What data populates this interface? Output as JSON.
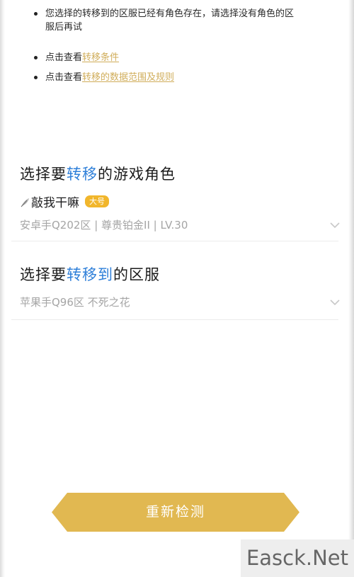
{
  "notes": {
    "items": [
      {
        "text": "您选择的转移到的区服已经有角色存在，请选择没有角色的区服后再试"
      },
      {
        "prefix": "点击查看",
        "link": "转移条件"
      },
      {
        "prefix": "点击查看",
        "link": "转移的数据范围及规则"
      }
    ]
  },
  "role_section": {
    "title_before": "选择要",
    "title_highlight": "转移",
    "title_after": "的游戏角色",
    "icon": "feather-icon",
    "role_name": "敲我干嘛",
    "badge": "大号",
    "role_info": "安卓手Q202区 | 尊贵铂金II | LV.30"
  },
  "server_section": {
    "title_before": "选择要",
    "title_highlight": "转移到",
    "title_after": "的区服",
    "selected_server": "苹果手Q96区 不死之花"
  },
  "cta": {
    "label": "重新检测"
  },
  "watermark": {
    "text": "Easck.Net"
  },
  "colors": {
    "accent_blue": "#2e7fd9",
    "gold": "#e1b851",
    "badge": "#f1b62c",
    "link": "#d0ad5a"
  }
}
